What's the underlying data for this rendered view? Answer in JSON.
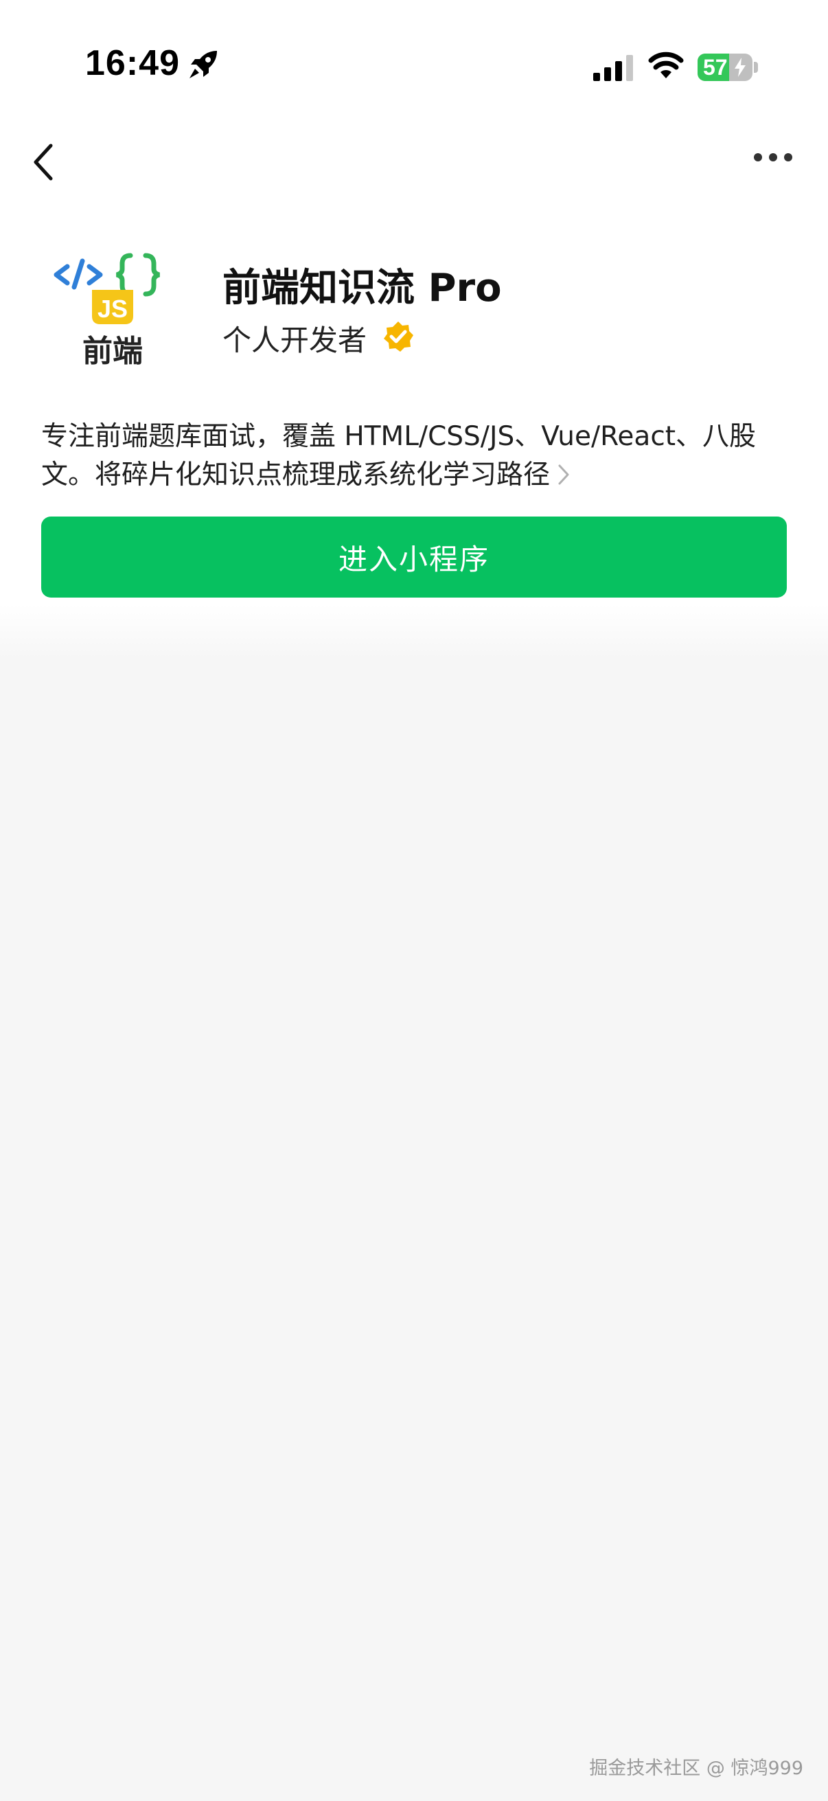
{
  "status_bar": {
    "time": "16:49",
    "battery_level": "57",
    "battery_fraction": 0.57
  },
  "nav": {
    "back_icon": "chevron-left-icon",
    "more_icon": "more-dots-icon"
  },
  "app": {
    "logo_icon": "code-js-logo-icon",
    "logo_text": "前端",
    "logo_badge": "JS",
    "name": "前端知识流 Pro",
    "developer_type": "个人开发者",
    "verified_icon": "verified-badge-icon",
    "description": "专注前端题库面试，覆盖 HTML/CSS/JS、Vue/React、八股文。将碎片化知识点梳理成系统化学习路径"
  },
  "actions": {
    "enter_label": "进入小程序"
  },
  "watermark": "掘金技术社区 @ 惊鸿999",
  "colors": {
    "accent_green": "#07c160",
    "battery_green": "#34c759",
    "verified_yellow": "#f7b500",
    "logo_blue": "#2f7fd8",
    "logo_green": "#34b55a",
    "logo_yellow": "#f5c518"
  }
}
